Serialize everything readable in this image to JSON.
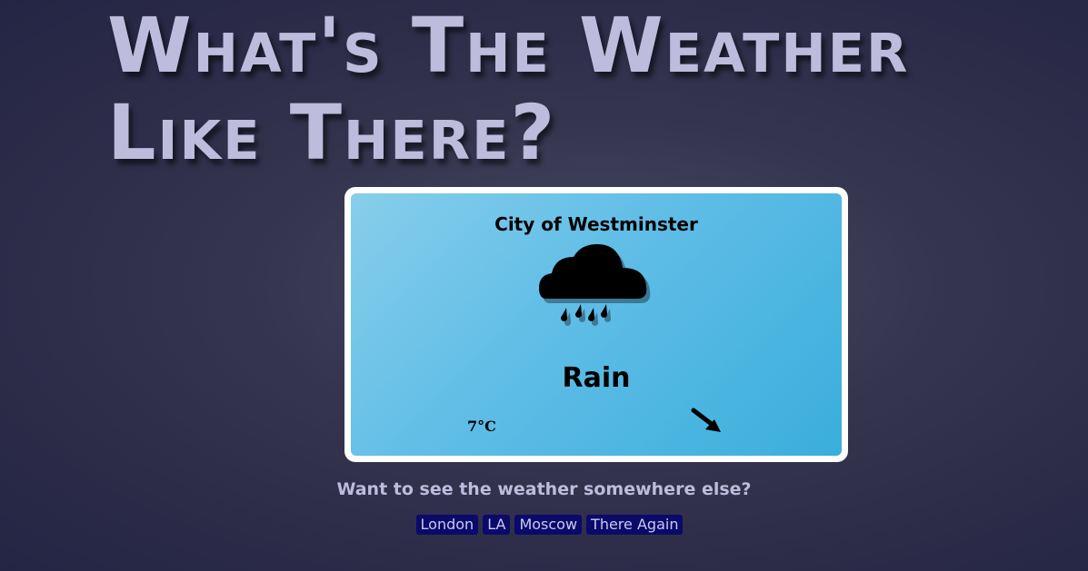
{
  "header": {
    "title": "What's The Weather Like There?"
  },
  "weather": {
    "city": "City of Westminster",
    "condition": "Rain",
    "temperature": "7°C",
    "icon": "rain-cloud-icon",
    "wind_icon": "wind-direction-arrow-icon"
  },
  "prompt": {
    "text": "Want to see the weather somewhere else?"
  },
  "cities": [
    {
      "label": "London"
    },
    {
      "label": "LA"
    },
    {
      "label": "Moscow"
    },
    {
      "label": "There Again"
    }
  ],
  "colors": {
    "title": "#bdbcdc",
    "card_border": "#ffffff",
    "card_gradient_start": "#87ceeb",
    "card_gradient_end": "#3aaedc",
    "link_background": "#0a0a6a",
    "link_text": "#c9c8ee"
  }
}
